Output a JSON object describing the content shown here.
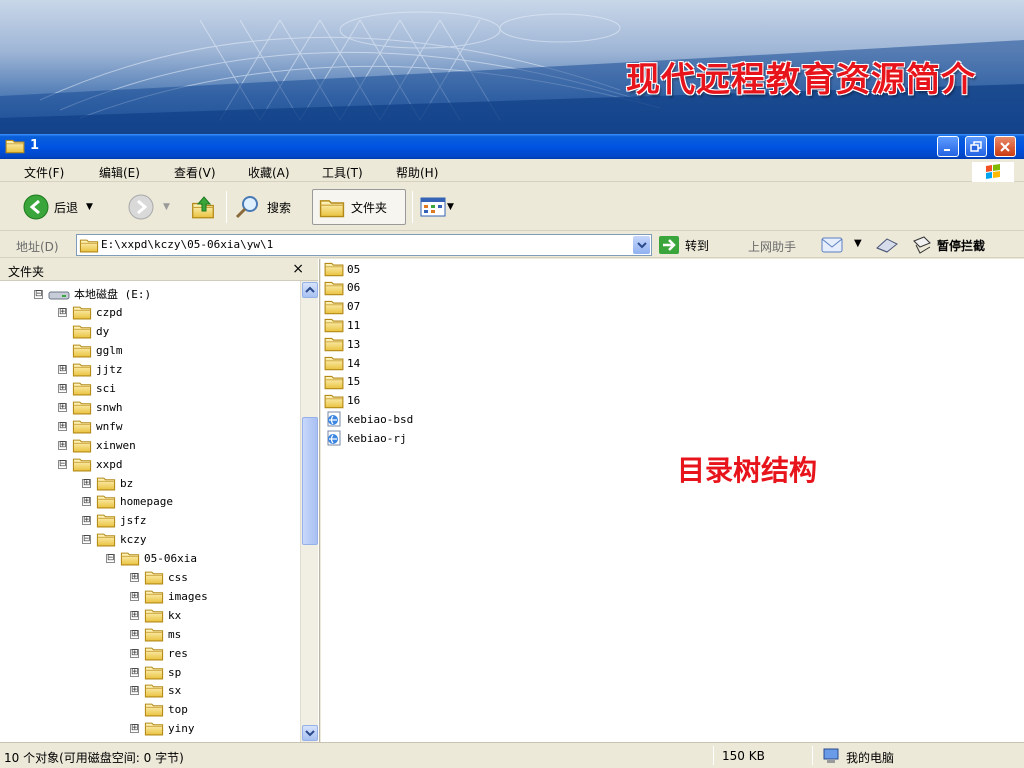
{
  "slide": {
    "title": "现代远程教育资源简介",
    "annotation": "目录树结构"
  },
  "window": {
    "title": "1"
  },
  "menu": [
    "文件(F)",
    "编辑(E)",
    "查看(V)",
    "收藏(A)",
    "工具(T)",
    "帮助(H)"
  ],
  "toolbar": {
    "back": "后退",
    "search": "搜索",
    "folders": "文件夹"
  },
  "address": {
    "label": "地址(D)",
    "value": "E:\\xxpd\\kczy\\05-06xia\\yw\\1",
    "go": "转到",
    "assistant": "上网助手",
    "popup_blocker": "暂停拦截"
  },
  "folder_pane": {
    "title": "文件夹",
    "close": "×",
    "nodes": [
      {
        "label": "本地磁盘 (E:)",
        "toggle": "⊟"
      },
      {
        "label": "czpd",
        "toggle": "⊞"
      },
      {
        "label": "dy",
        "toggle": ""
      },
      {
        "label": "gglm",
        "toggle": ""
      },
      {
        "label": "jjtz",
        "toggle": "⊞"
      },
      {
        "label": "sci",
        "toggle": "⊞"
      },
      {
        "label": "snwh",
        "toggle": "⊞"
      },
      {
        "label": "wnfw",
        "toggle": "⊞"
      },
      {
        "label": "xinwen",
        "toggle": "⊞"
      },
      {
        "label": "xxpd",
        "toggle": "⊟"
      },
      {
        "label": "bz",
        "toggle": "⊞"
      },
      {
        "label": "homepage",
        "toggle": "⊞"
      },
      {
        "label": "jsfz",
        "toggle": "⊞"
      },
      {
        "label": "kczy",
        "toggle": "⊟"
      },
      {
        "label": "05-06xia",
        "toggle": "⊟"
      },
      {
        "label": "css",
        "toggle": "⊞"
      },
      {
        "label": "images",
        "toggle": "⊞"
      },
      {
        "label": "kx",
        "toggle": "⊞"
      },
      {
        "label": "ms",
        "toggle": "⊞"
      },
      {
        "label": "res",
        "toggle": "⊞"
      },
      {
        "label": "sp",
        "toggle": "⊞"
      },
      {
        "label": "sx",
        "toggle": "⊞"
      },
      {
        "label": "top",
        "toggle": ""
      },
      {
        "label": "yiny",
        "toggle": "⊞"
      }
    ]
  },
  "files": [
    {
      "name": "05",
      "icon": "folder-icon"
    },
    {
      "name": "06",
      "icon": "folder-icon"
    },
    {
      "name": "07",
      "icon": "folder-icon"
    },
    {
      "name": "11",
      "icon": "folder-icon"
    },
    {
      "name": "13",
      "icon": "folder-icon"
    },
    {
      "name": "14",
      "icon": "folder-icon"
    },
    {
      "name": "15",
      "icon": "folder-icon"
    },
    {
      "name": "16",
      "icon": "folder-icon"
    },
    {
      "name": "kebiao-bsd",
      "icon": "ie-document-icon"
    },
    {
      "name": "kebiao-rj",
      "icon": "ie-document-icon"
    }
  ],
  "status": {
    "objects": "10 个对象(可用磁盘空间: 0 字节)",
    "size": "150 KB",
    "zone": "我的电脑"
  },
  "colors": {
    "title_red": "#e8141b",
    "xp_blue": "#0054e3",
    "chrome": "#ece9d8"
  }
}
